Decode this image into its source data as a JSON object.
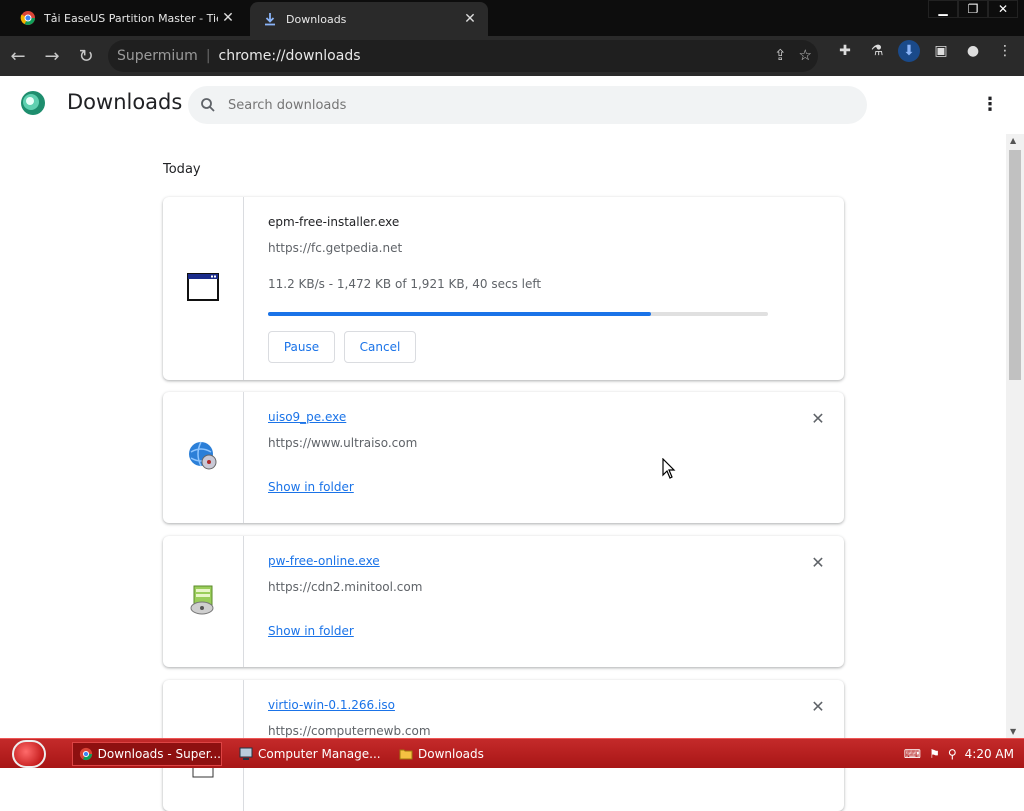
{
  "browser": {
    "tabs": [
      {
        "title": "Tải EaseUS Partition Master - Tiện í",
        "active": false
      },
      {
        "title": "Downloads",
        "active": true
      }
    ],
    "omnibox": {
      "browser_name": "Supermium",
      "separator": "|",
      "url": "chrome://downloads"
    },
    "window_controls": [
      "minimize",
      "restore",
      "close"
    ]
  },
  "downloads_page": {
    "title": "Downloads",
    "search_placeholder": "Search downloads",
    "section_label": "Today",
    "items": [
      {
        "filename": "epm-free-installer.exe",
        "source": "https://fc.getpedia.net",
        "status": "11.2 KB/s - 1,472 KB of 1,921 KB, 40 secs left",
        "progress": 0.766,
        "actions": [
          "Pause",
          "Cancel"
        ],
        "icon": "window-app-icon"
      },
      {
        "filename": "uiso9_pe.exe",
        "source": "https://www.ultraiso.com",
        "action": "Show in folder",
        "icon": "globe-cd-icon"
      },
      {
        "filename": "pw-free-online.exe",
        "source": "https://cdn2.minitool.com",
        "action": "Show in folder",
        "icon": "installer-disk-icon"
      },
      {
        "filename": "virtio-win-0.1.266.iso",
        "source": "https://computernewb.com",
        "icon": "file-icon"
      }
    ]
  },
  "taskbar": {
    "tasks": [
      {
        "label": "Downloads - Super...",
        "icon": "chrome-icon"
      },
      {
        "label": "Computer Manage...",
        "icon": "computer-management-icon"
      },
      {
        "label": "Downloads",
        "icon": "folder-icon"
      }
    ],
    "clock": "4:20 AM"
  },
  "colors": {
    "accent": "#1a73e8",
    "taskbar": "#b51c1c",
    "chrome_dark": "#2a2a2a"
  }
}
